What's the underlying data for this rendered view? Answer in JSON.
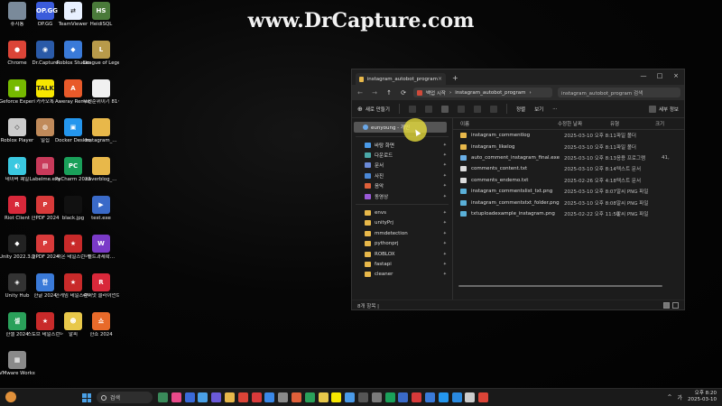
{
  "watermark": "www.DrCapture.com",
  "desktop_icons": [
    {
      "label": "휴지통",
      "color": "#7a8a9a",
      "glyph": "",
      "icon": "recycle-bin-icon"
    },
    {
      "label": "OP.GG",
      "color": "#3b5bdb",
      "glyph": "OP.GG",
      "icon": "opgg-icon"
    },
    {
      "label": "TeamViewer",
      "color": "#e8f0ff",
      "glyph": "⇄",
      "icon": "teamviewer-icon"
    },
    {
      "label": "HeidiSQL",
      "color": "#4a7a3a",
      "glyph": "HS",
      "icon": "heidisql-icon"
    },
    {
      "label": "Chrome",
      "color": "#db4437",
      "glyph": "●",
      "icon": "chrome-icon"
    },
    {
      "label": "Dr.Capture",
      "color": "#2a5aa8",
      "glyph": "◉",
      "icon": "drcapture-icon"
    },
    {
      "label": "Roblox Studio",
      "color": "#3a7ad8",
      "glyph": "◆",
      "icon": "roblox-studio-icon"
    },
    {
      "label": "League of Legends",
      "color": "#b89a4a",
      "glyph": "L",
      "icon": "league-icon"
    },
    {
      "label": "Geforce Experience",
      "color": "#76b900",
      "glyph": "◼",
      "icon": "geforce-icon"
    },
    {
      "label": "카카오톡",
      "color": "#f7e600",
      "glyph": "TALK",
      "icon": "kakaotalk-icon"
    },
    {
      "label": "Aweray Remote(A…",
      "color": "#e85a2a",
      "glyph": "A",
      "icon": "aweray-icon"
    },
    {
      "label": "우선순위이기 81~85.txt",
      "color": "#f0f0f0",
      "glyph": "",
      "icon": "text-file-icon"
    },
    {
      "label": "Roblox Player",
      "color": "#cccccc",
      "glyph": "◇",
      "icon": "roblox-player-icon"
    },
    {
      "label": "밀집",
      "color": "#c08a5a",
      "glyph": "◍",
      "icon": "app-icon"
    },
    {
      "label": "Docker Desktop",
      "color": "#2496ed",
      "glyph": "▣",
      "icon": "docker-icon"
    },
    {
      "label": "instagram_…",
      "color": "#e8b84a",
      "glyph": "",
      "icon": "folder-icon"
    },
    {
      "label": "네이버 웨일",
      "color": "#3ac8e0",
      "glyph": "◐",
      "icon": "whale-icon"
    },
    {
      "label": "Labelme.exe",
      "color": "#c83a5a",
      "glyph": "▤",
      "icon": "labelme-icon"
    },
    {
      "label": "PyCharm 2023.2.5",
      "color": "#1aa05a",
      "glyph": "PC",
      "icon": "pycharm-icon"
    },
    {
      "label": "naverblog_…",
      "color": "#e8b84a",
      "glyph": "",
      "icon": "folder-icon"
    },
    {
      "label": "Riot Client",
      "color": "#d8283a",
      "glyph": "R",
      "icon": "riot-icon"
    },
    {
      "label": "한PDF 2024",
      "color": "#d83a3a",
      "glyph": "P",
      "icon": "hanpdf-icon"
    },
    {
      "label": "black.jpg",
      "color": "#111111",
      "glyph": "",
      "icon": "image-file-icon"
    },
    {
      "label": "test.exe",
      "color": "#3a6ac8",
      "glyph": "▶",
      "icon": "exe-file-icon"
    },
    {
      "label": "Unity 2022.3.17f1",
      "color": "#222222",
      "glyph": "◆",
      "icon": "unity-icon"
    },
    {
      "label": "한PDF 2024",
      "color": "#d83a3a",
      "glyph": "P",
      "icon": "hanpdf-icon"
    },
    {
      "label": "라온 테일즈런너",
      "color": "#c82a2a",
      "glyph": "★",
      "icon": "talesrunner-icon"
    },
    {
      "label": "별트과제확…",
      "color": "#7a3ac8",
      "glyph": "W",
      "icon": "app-icon"
    },
    {
      "label": "Unity Hub",
      "color": "#333333",
      "glyph": "◈",
      "icon": "unity-hub-icon"
    },
    {
      "label": "한글 2024",
      "color": "#3a7ad8",
      "glyph": "한",
      "icon": "hangul-icon"
    },
    {
      "label": "한게임 테일즈런너",
      "color": "#c82a2a",
      "glyph": "★",
      "icon": "talesrunner-icon"
    },
    {
      "label": "라이엇 클라이언트",
      "color": "#d8283a",
      "glyph": "R",
      "icon": "riot-icon"
    },
    {
      "label": "한셀 2024",
      "color": "#2aa05a",
      "glyph": "셀",
      "icon": "hancell-icon"
    },
    {
      "label": "스토브 테일즈런너",
      "color": "#c82a2a",
      "glyph": "★",
      "icon": "talesrunner-icon"
    },
    {
      "label": "말피",
      "color": "#e8c84a",
      "glyph": "☻",
      "icon": "app-icon"
    },
    {
      "label": "한쇼 2024",
      "color": "#e86a2a",
      "glyph": "쇼",
      "icon": "hanshow-icon"
    },
    {
      "label": "VMware Workstati…",
      "color": "#8a8a8a",
      "glyph": "▦",
      "icon": "vmware-icon"
    }
  ],
  "explorer": {
    "tab_title": "instagram_autobot_program",
    "tab_close": "×",
    "new_tab": "+",
    "win_min": "—",
    "win_max": "□",
    "win_close": "×",
    "nav_back": "←",
    "nav_forward": "→",
    "nav_up": "↑",
    "nav_refresh": "⟳",
    "breadcrumb_sep": "›",
    "breadcrumb_1": "백업 시작",
    "breadcrumb_2": "instagram_autobot_program",
    "search_placeholder": "instagram_autobot_program 검색",
    "new_label": "새로 만들기",
    "sort_label": "정렬",
    "view_label": "보기",
    "more_label": "···",
    "details_label": "세부 정보",
    "user_label": "eunyoung - 개인",
    "nav_items": [
      {
        "label": "바탕 화면",
        "color": "#4a9ae8",
        "icon": "desktop-icon"
      },
      {
        "label": "다운로드",
        "color": "#4aa8a8",
        "icon": "download-icon"
      },
      {
        "label": "문서",
        "color": "#6a8ad8",
        "icon": "documents-icon"
      },
      {
        "label": "사진",
        "color": "#4a88d8",
        "icon": "pictures-icon"
      },
      {
        "label": "음악",
        "color": "#e0603a",
        "icon": "music-icon"
      },
      {
        "label": "동영상",
        "color": "#9a5ad8",
        "icon": "videos-icon"
      },
      {
        "label": "envs",
        "color": "#e8b84a",
        "icon": "folder-icon"
      },
      {
        "label": "unityPrj",
        "color": "#e8b84a",
        "icon": "folder-icon"
      },
      {
        "label": "mmdetection",
        "color": "#e8b84a",
        "icon": "folder-icon"
      },
      {
        "label": "pythonprj",
        "color": "#e8b84a",
        "icon": "folder-icon"
      },
      {
        "label": "ROBLOX",
        "color": "#e8b84a",
        "icon": "folder-icon"
      },
      {
        "label": "fastapi",
        "color": "#e8b84a",
        "icon": "folder-icon"
      },
      {
        "label": "cleaner",
        "color": "#e8b84a",
        "icon": "folder-icon"
      }
    ],
    "columns": {
      "name": "이름",
      "date": "수정한 날짜",
      "type": "유형",
      "size": "크기"
    },
    "files": [
      {
        "name": "instagram_commentlog",
        "date": "2025-03-10 오후 8:11",
        "type": "파일 폴더",
        "size": "",
        "color": "#e8b84a",
        "icon": "folder-icon"
      },
      {
        "name": "instagram_likelog",
        "date": "2025-03-10 오후 8:11",
        "type": "파일 폴더",
        "size": "",
        "color": "#e8b84a",
        "icon": "folder-icon"
      },
      {
        "name": "auto_comment_instagram_final.exe",
        "date": "2025-03-10 오후 8:13",
        "type": "응용 프로그램",
        "size": "41,",
        "color": "#6ab0e8",
        "icon": "exe-file-icon"
      },
      {
        "name": "comments_content.txt",
        "date": "2025-03-10 오후 8:14",
        "type": "텍스트 문서",
        "size": "",
        "color": "#dddddd",
        "icon": "text-file-icon"
      },
      {
        "name": "comments_endemo.txt",
        "date": "2025-02-26 오후 4:18",
        "type": "텍스트 문서",
        "size": "",
        "color": "#dddddd",
        "icon": "text-file-icon"
      },
      {
        "name": "instagram_commentslist_txt.png",
        "date": "2025-03-10 오후 8:07",
        "type": "알씨 PNG 파일",
        "size": "",
        "color": "#5ab0d8",
        "icon": "image-file-icon"
      },
      {
        "name": "instagram_commentstxt_folder.png",
        "date": "2025-03-10 오후 8:08",
        "type": "알씨 PNG 파일",
        "size": "",
        "color": "#5ab0d8",
        "icon": "image-file-icon"
      },
      {
        "name": "txtuploadexample_instagram.png",
        "date": "2025-02-22 오후 11:50",
        "type": "알씨 PNG 파일",
        "size": "",
        "color": "#5ab0d8",
        "icon": "image-file-icon"
      }
    ],
    "status_text": "8개 항목 |"
  },
  "taskbar": {
    "search_label": "검색",
    "ime": "가",
    "time": "오후 8:20",
    "date": "2025-03-10",
    "apps": [
      "#3a8a5a",
      "#e84a8a",
      "#3a6ad8",
      "#4aa0e6",
      "#6a5ad8",
      "#e8b84a",
      "#db4437",
      "#d83a3a",
      "#3a88e8",
      "#8a8a8a",
      "#e0603a",
      "#2aa05a",
      "#e8c84a",
      "#f7e600",
      "#4a9ae8",
      "#555555",
      "#7a7a7a",
      "#1aa05a",
      "#3a6ac8",
      "#d83a3a",
      "#3a7ad8",
      "#2496ed",
      "#2a8ae0",
      "#cccccc",
      "#db4437"
    ]
  }
}
